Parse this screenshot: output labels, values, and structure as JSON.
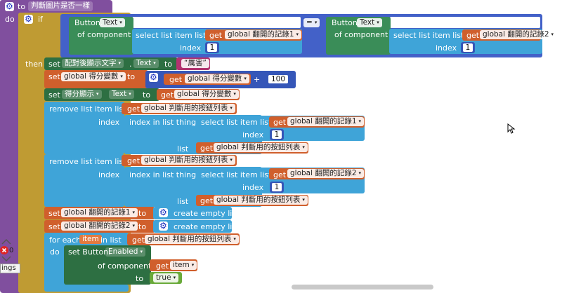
{
  "procedure": {
    "to_label": "to",
    "name": "判斷圖片是否一樣",
    "do_label": "do"
  },
  "if_block": {
    "if_label": "if",
    "then_label": "then",
    "operator": "="
  },
  "compare_left": {
    "component": "Button.",
    "property": "Text",
    "of_component": "of component",
    "select_list": "select list item  list",
    "get": "get",
    "var": "global 翻開的記錄1",
    "index_label": "index",
    "index_value": "1"
  },
  "compare_right": {
    "component": "Button.",
    "property": "Text",
    "of_component": "of component",
    "select_list": "select list item  list",
    "get": "get",
    "var": "global 翻開的記錄2",
    "index_label": "index",
    "index_value": "1"
  },
  "stmt1": {
    "set": "set",
    "target": "配對後顯示文字",
    "dot": ".",
    "property": "Text",
    "to": "to",
    "text_value": "厲害"
  },
  "stmt2": {
    "set": "set",
    "var": "global 得分變數",
    "to": "to",
    "get": "get",
    "get_var": "global 得分變數",
    "plus": "+",
    "number": "100"
  },
  "stmt3": {
    "set": "set",
    "target": "得分顯示",
    "property": "Text",
    "to": "to",
    "get": "get",
    "get_var": "global 得分變數"
  },
  "remove1": {
    "label": "remove list item  list",
    "get": "get",
    "list_var": "global 判斷用的按鈕列表",
    "index_label": "index",
    "index_in_list": "index in list  thing",
    "select_list": "select list item  list",
    "sel_get": "get",
    "sel_var": "global 翻開的記錄1",
    "sel_index_label": "index",
    "sel_index": "1",
    "list_label": "list",
    "list_get": "get",
    "list_get_var": "global 判斷用的按鈕列表"
  },
  "remove2": {
    "label": "remove list item  list",
    "get": "get",
    "list_var": "global 判斷用的按鈕列表",
    "index_label": "index",
    "index_in_list": "index in list  thing",
    "select_list": "select list item  list",
    "sel_get": "get",
    "sel_var": "global 翻開的記錄2",
    "sel_index_label": "index",
    "sel_index": "1",
    "list_label": "list",
    "list_get": "get",
    "list_get_var": "global 判斷用的按鈕列表"
  },
  "set_rec1": {
    "set": "set",
    "var": "global 翻開的記錄1",
    "to": "to",
    "value": "create empty list"
  },
  "set_rec2": {
    "set": "set",
    "var": "global 翻開的記錄2",
    "to": "to",
    "value": "create empty list"
  },
  "foreach": {
    "label": "for each",
    "item": "item",
    "in_list": "in list",
    "get": "get",
    "var": "global 判斷用的按鈕列表",
    "do_label": "do"
  },
  "set_enabled": {
    "set": "set Button.",
    "property": "Enabled",
    "of_component": "of component",
    "get": "get",
    "get_var": "item",
    "to": "to",
    "value": "true"
  },
  "side": {
    "warning_count": "0",
    "settings_text": "ings"
  }
}
